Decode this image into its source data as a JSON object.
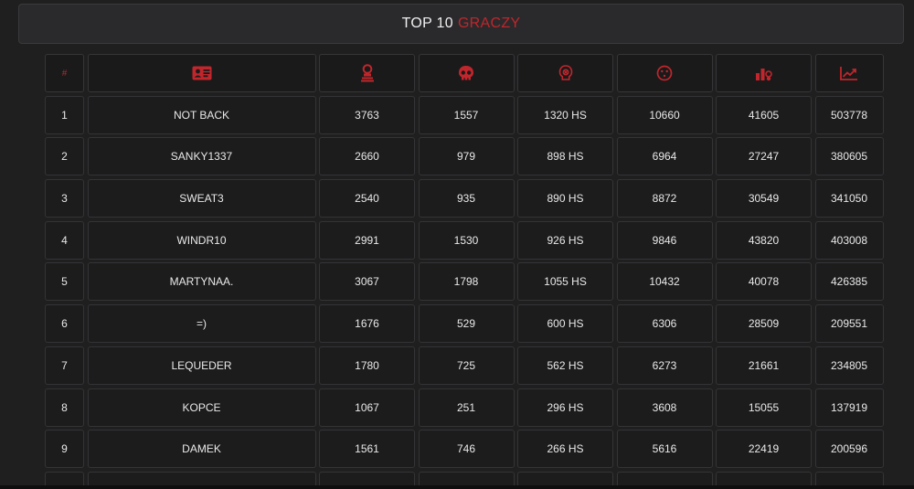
{
  "title": {
    "part1": "TOP 10",
    "part2": "GRACZY"
  },
  "colors": {
    "accent": "#c0262b",
    "background": "#1f1f20",
    "cell": "#1c1c1d"
  },
  "header": [
    {
      "type": "text",
      "text": "#",
      "name": "col-rank"
    },
    {
      "type": "icon",
      "icon": "id-card-icon",
      "name": "col-name"
    },
    {
      "type": "icon",
      "icon": "grave-icon",
      "name": "col-kills"
    },
    {
      "type": "icon",
      "icon": "skull-icon",
      "name": "col-deaths"
    },
    {
      "type": "icon",
      "icon": "headshot-icon",
      "name": "col-headshots"
    },
    {
      "type": "icon",
      "icon": "target-icon",
      "name": "col-shots"
    },
    {
      "type": "icon",
      "icon": "damage-icon",
      "name": "col-damage"
    },
    {
      "type": "icon",
      "icon": "chart-icon",
      "name": "col-points"
    }
  ],
  "rows": [
    [
      "1",
      "NOT BACK",
      "3763",
      "1557",
      "1320 HS",
      "10660",
      "41605",
      "503778"
    ],
    [
      "2",
      "SANKY1337",
      "2660",
      "979",
      "898 HS",
      "6964",
      "27247",
      "380605"
    ],
    [
      "3",
      "SWEAT3",
      "2540",
      "935",
      "890 HS",
      "8872",
      "30549",
      "341050"
    ],
    [
      "4",
      "WINDR10",
      "2991",
      "1530",
      "926 HS",
      "9846",
      "43820",
      "403008"
    ],
    [
      "5",
      "MARTYNAA.",
      "3067",
      "1798",
      "1055 HS",
      "10432",
      "40078",
      "426385"
    ],
    [
      "6",
      "=)",
      "1676",
      "529",
      "600 HS",
      "6306",
      "28509",
      "209551"
    ],
    [
      "7",
      "LEQUEDER",
      "1780",
      "725",
      "562 HS",
      "6273",
      "21661",
      "234805"
    ],
    [
      "8",
      "KOPCE",
      "1067",
      "251",
      "296 HS",
      "3608",
      "15055",
      "137919"
    ],
    [
      "9",
      "DAMEK",
      "1561",
      "746",
      "266 HS",
      "5616",
      "22419",
      "200596"
    ],
    [
      "",
      "",
      "",
      "",
      "",
      "",
      "",
      ""
    ]
  ]
}
